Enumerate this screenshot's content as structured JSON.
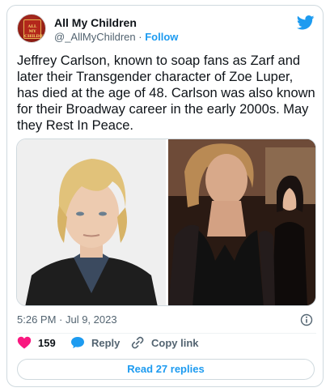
{
  "author": {
    "name": "All My Children",
    "handle": "@_AllMyChildren",
    "separator": "·",
    "follow_label": "Follow",
    "avatar_text": "All My Children"
  },
  "tweet": {
    "text": "Jeffrey Carlson, known to soap fans as Zarf and later their Transgender character of Zoe Luper, has died at the age of 48. Carlson was also known for their Broadway career in the early 2000s. May they Rest In Peace.",
    "timestamp": "5:26 PM · Jul 9, 2023"
  },
  "actions": {
    "like_count": "159",
    "reply_label": "Reply",
    "copy_link_label": "Copy link"
  },
  "read_replies_label": "Read 27 replies",
  "colors": {
    "brand_blue": "#1d9bf0",
    "like_red": "#f91880",
    "text_primary": "#0f1419",
    "text_secondary": "#536471",
    "border": "#cfd9de"
  },
  "icons": {
    "brand": "twitter-bird-icon",
    "info": "info-icon",
    "like": "heart-icon",
    "reply": "reply-bubble-icon",
    "copy": "link-icon"
  }
}
